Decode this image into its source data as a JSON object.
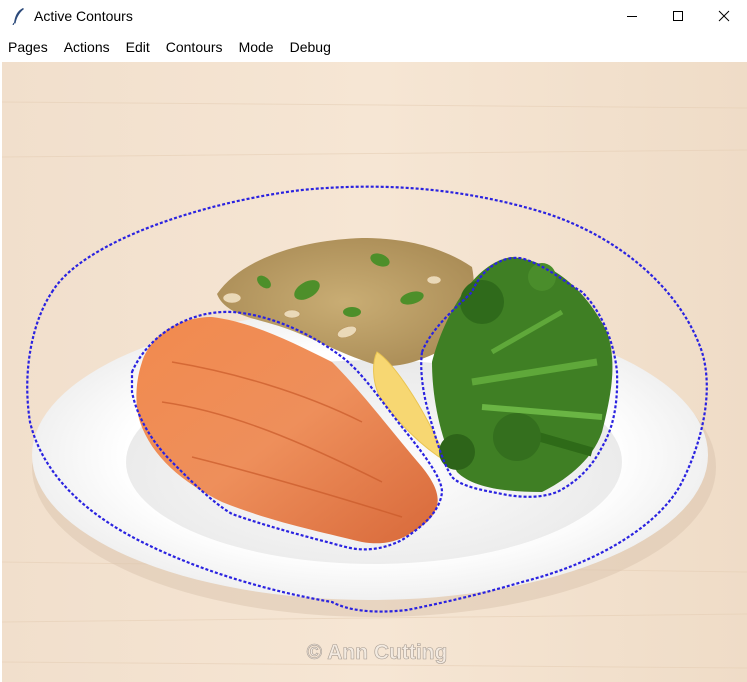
{
  "window": {
    "title": "Active Contours",
    "app_icon": "feather-icon",
    "controls": [
      "minimize-icon",
      "maximize-icon",
      "close-icon"
    ]
  },
  "menubar": {
    "items": [
      {
        "label": "Pages"
      },
      {
        "label": "Actions"
      },
      {
        "label": "Edit"
      },
      {
        "label": "Contours"
      },
      {
        "label": "Mode"
      },
      {
        "label": "Debug"
      }
    ]
  },
  "canvas": {
    "watermark": "© Ann Cutting",
    "image_subject": "salmon-fillet-with-grain-salad-lemon-and-broccolini-on-white-plate",
    "contour_color": "#2a22e0",
    "contours": [
      "plate-contour",
      "salmon-contour",
      "broccoli-contour"
    ]
  }
}
